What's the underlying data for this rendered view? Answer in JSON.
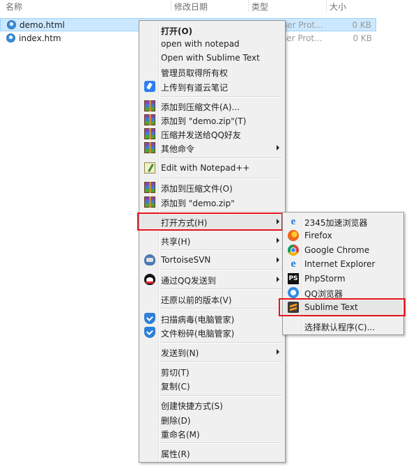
{
  "columns": {
    "name": "名称",
    "modified": "修改日期",
    "type": "类型",
    "size": "大小"
  },
  "files": [
    {
      "name": "demo.html",
      "type": "ser Prot...",
      "size": "0 KB"
    },
    {
      "name": "index.htm",
      "type": "ser Prot...",
      "size": "0 KB"
    }
  ],
  "context_menu": {
    "items": {
      "open": "打开(O)",
      "open_notepad": "open with notepad",
      "open_sublime": "Open with Sublime Text",
      "admin_ownership": "管理员取得所有权",
      "upload_youdao": "上传到有道云笔记",
      "add_archive": "添加到压缩文件(A)...",
      "add_demo_zip_t": "添加到 \"demo.zip\"(T)",
      "compress_send_qq": "压缩并发送给QQ好友",
      "other_commands": "其他命令",
      "edit_notepadpp": "Edit with Notepad++",
      "add_archive_o": "添加到压缩文件(O)",
      "add_demo_zip": "添加到 \"demo.zip\"",
      "open_with": "打开方式(H)",
      "share": "共享(H)",
      "tortoisesvn": "TortoiseSVN",
      "send_via_qq": "通过QQ发送到",
      "restore_previous": "还原以前的版本(V)",
      "scan_virus": "扫描病毒(电脑管家)",
      "shred_file": "文件粉碎(电脑管家)",
      "send_to": "发送到(N)",
      "cut": "剪切(T)",
      "copy": "复制(C)",
      "create_shortcut": "创建快捷方式(S)",
      "delete": "删除(D)",
      "rename": "重命名(M)",
      "properties": "属性(R)"
    }
  },
  "open_with_menu": {
    "items": {
      "b2345": "2345加速浏览器",
      "firefox": "Firefox",
      "chrome": "Google Chrome",
      "ie": "Internet Explorer",
      "phpstorm": "PhpStorm",
      "qqbrowser": "QQ浏览器",
      "sublime": "Sublime Text",
      "choose_default": "选择默认程序(C)..."
    },
    "icon_text": {
      "ps": "PS",
      "e2345": "e",
      "ie": "e"
    }
  },
  "colors": {
    "highlight_box": "#e8141c",
    "selection_bg": "#cce8ff",
    "menu_bg": "#f0f0f0"
  }
}
